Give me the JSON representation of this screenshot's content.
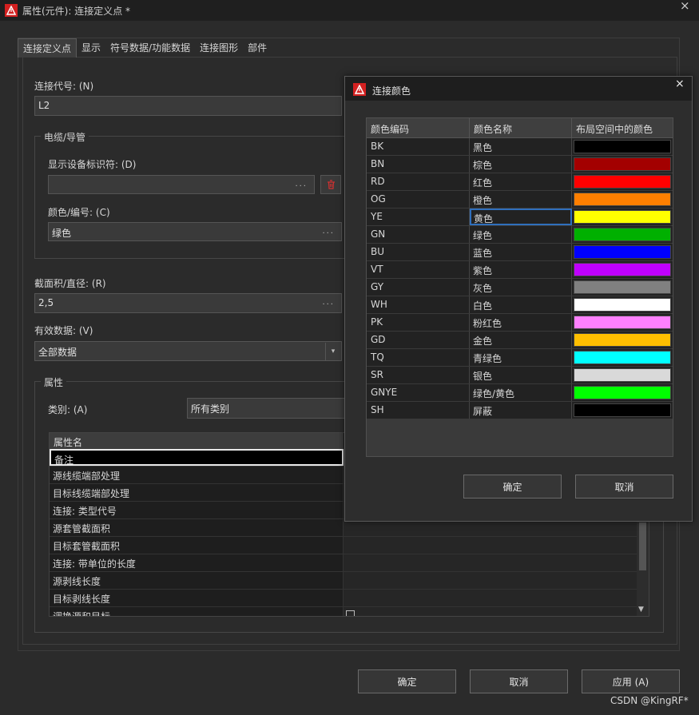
{
  "window": {
    "title": "属性(元件): 连接定义点 *",
    "close": "×"
  },
  "tabs": [
    "连接定义点",
    "显示",
    "符号数据/功能数据",
    "连接图形",
    "部件"
  ],
  "form": {
    "conn_code_label": "连接代号: (N)",
    "conn_code_value": "L2",
    "cable_group_title": "电缆/导管",
    "device_tag_label": "显示设备标识符: (D)",
    "device_tag_value": "",
    "color_label": "颜色/编号: (C)",
    "color_value": "绿色",
    "cross_section_label": "截面积/直径: (R)",
    "cross_section_value": "2,5",
    "valid_data_label": "有效数据: (V)",
    "valid_data_value": "全部数据",
    "props_group_title": "属性",
    "category_label": "类别: (A)",
    "category_value": "所有类别",
    "dots": "..."
  },
  "props_table": {
    "header": "属性名",
    "rows": [
      "备注",
      "源线缆端部处理",
      "目标线缆端部处理",
      "连接: 类型代号",
      "源套管截面积",
      "目标套管截面积",
      "连接: 带单位的长度",
      "源剥线长度",
      "目标剥线长度",
      "调换源和目标"
    ]
  },
  "footer": {
    "ok": "确定",
    "cancel": "取消",
    "apply": "应用 (A)"
  },
  "watermark": "CSDN @KingRF*",
  "dialog": {
    "title": "连接颜色",
    "close": "×",
    "headers": [
      "颜色编码",
      "颜色名称",
      "布局空间中的颜色"
    ],
    "rows": [
      {
        "code": "BK",
        "name": "黑色",
        "color": "#000000"
      },
      {
        "code": "BN",
        "name": "棕色",
        "color": "#a30000"
      },
      {
        "code": "RD",
        "name": "红色",
        "color": "#ff0000"
      },
      {
        "code": "OG",
        "name": "橙色",
        "color": "#ff7f00"
      },
      {
        "code": "YE",
        "name": "黄色",
        "color": "#ffff00"
      },
      {
        "code": "GN",
        "name": "绿色",
        "color": "#00b000"
      },
      {
        "code": "BU",
        "name": "蓝色",
        "color": "#0000ff"
      },
      {
        "code": "VT",
        "name": "紫色",
        "color": "#bf00ff"
      },
      {
        "code": "GY",
        "name": "灰色",
        "color": "#808080"
      },
      {
        "code": "WH",
        "name": "白色",
        "color": "#ffffff"
      },
      {
        "code": "PK",
        "name": "粉红色",
        "color": "#ff80ff"
      },
      {
        "code": "GD",
        "name": "金色",
        "color": "#ffbf00"
      },
      {
        "code": "TQ",
        "name": "青绿色",
        "color": "#00ffff"
      },
      {
        "code": "SR",
        "name": "银色",
        "color": "#d9d9d9"
      },
      {
        "code": "GNYE",
        "name": "绿色/黄色",
        "color": "#00ff00"
      },
      {
        "code": "SH",
        "name": "屏蔽",
        "color": "#000000"
      }
    ],
    "ok": "确定",
    "cancel": "取消"
  }
}
